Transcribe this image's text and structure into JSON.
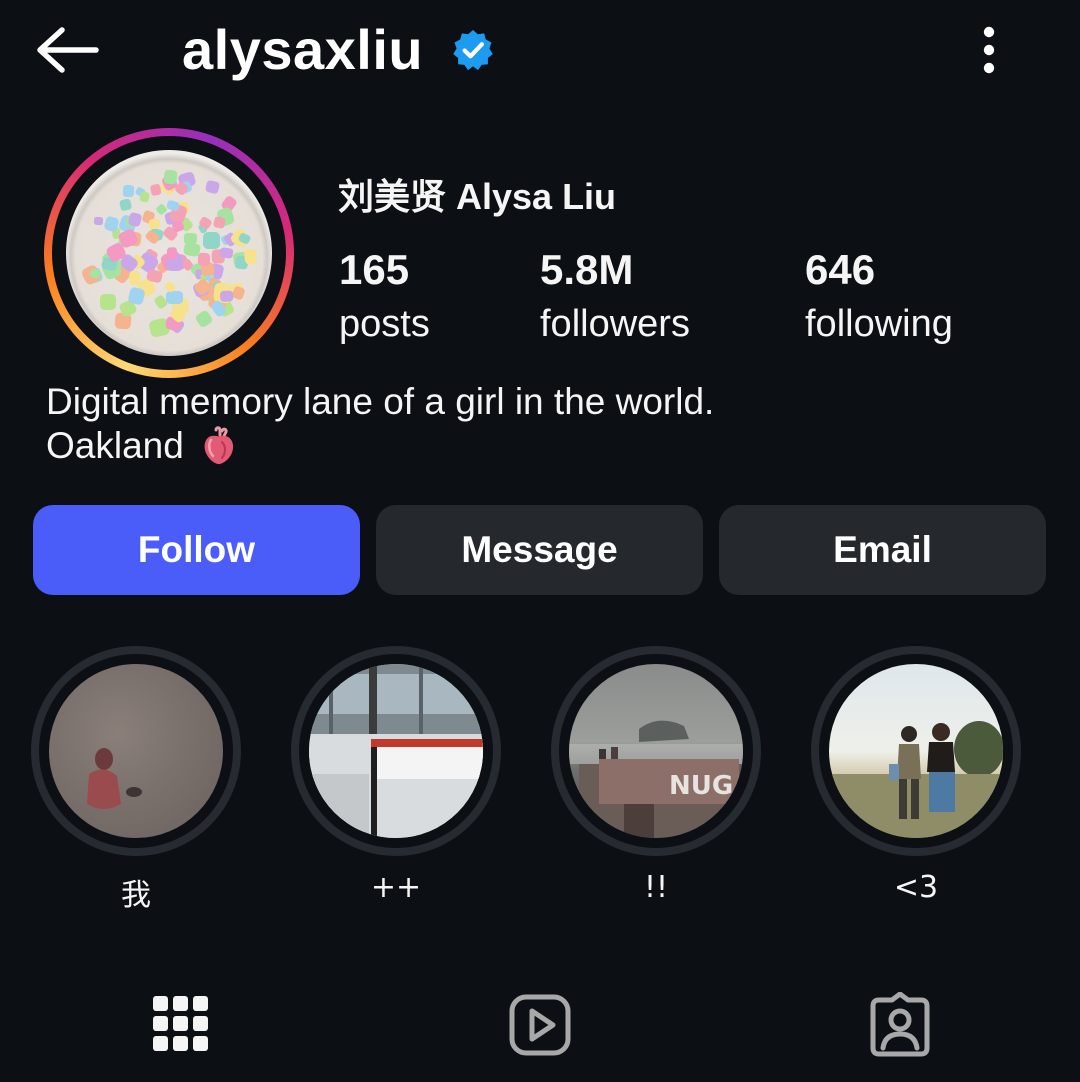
{
  "header": {
    "back_icon": "arrow-left-icon",
    "username": "alysaxliu",
    "verified_icon": "verified-badge-icon",
    "more_icon": "vertical-ellipsis-icon"
  },
  "profile": {
    "full_name": "刘美贤 Alysa Liu",
    "stats": [
      {
        "value": "165",
        "label": "posts"
      },
      {
        "value": "5.8M",
        "label": "followers"
      },
      {
        "value": "646",
        "label": "following"
      }
    ],
    "bio": {
      "line1": "Digital memory lane of a girl in the world.",
      "line2": "Oakland",
      "line2_emoji": "anatomical-heart-icon"
    }
  },
  "actions": {
    "follow_label": "Follow",
    "message_label": "Message",
    "email_label": "Email"
  },
  "highlights": [
    {
      "label": "我"
    },
    {
      "label": "++"
    },
    {
      "label": "!!"
    },
    {
      "label": "<3"
    }
  ],
  "tabs": [
    {
      "icon": "grid-icon"
    },
    {
      "icon": "reels-icon"
    },
    {
      "icon": "tagged-icon"
    }
  ],
  "colors": {
    "background": "#0c1014",
    "follow_button": "#4a5df9",
    "secondary_button": "#25292e",
    "verified": "#1d9bf0"
  }
}
